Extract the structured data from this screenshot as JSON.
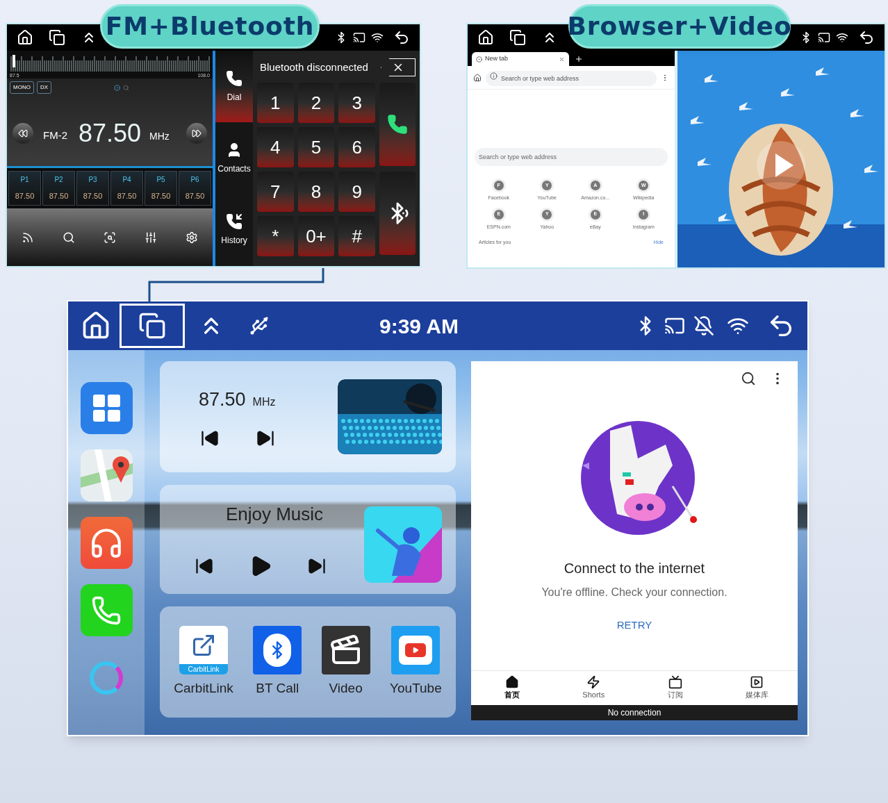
{
  "fm_bluetooth_panel": {
    "label": "FM+Bluetooth",
    "radio": {
      "scale_min": "87.5",
      "scale_max": "108.0",
      "modes": [
        "MONO",
        "DX"
      ],
      "band": "FM-2",
      "frequency": "87.50",
      "unit": "MHz",
      "presets": [
        {
          "name": "P1",
          "frequency": "87.50"
        },
        {
          "name": "P2",
          "frequency": "87.50"
        },
        {
          "name": "P3",
          "frequency": "87.50"
        },
        {
          "name": "P4",
          "frequency": "87.50"
        },
        {
          "name": "P5",
          "frequency": "87.50"
        },
        {
          "name": "P6",
          "frequency": "87.50"
        }
      ]
    },
    "phone": {
      "nav": [
        {
          "kind": "dial",
          "label": "Dial",
          "selected": true
        },
        {
          "kind": "contacts",
          "label": "Contacts",
          "selected": false
        },
        {
          "kind": "history",
          "label": "History",
          "selected": false
        }
      ],
      "status": "Bluetooth disconnected",
      "keys": [
        "1",
        "2",
        "3",
        "4",
        "5",
        "6",
        "7",
        "8",
        "9",
        "*",
        "0+",
        "#"
      ]
    }
  },
  "browser_video_panel": {
    "label": "Browser+Video",
    "browser": {
      "tab_title": "New tab",
      "address_placeholder": "Search or type web address",
      "search_placeholder": "Search or type web address",
      "shortcuts": [
        {
          "letter": "F",
          "name": "Facebook"
        },
        {
          "letter": "Y",
          "name": "YouTube"
        },
        {
          "letter": "A",
          "name": "Amazon.co..."
        },
        {
          "letter": "W",
          "name": "Wikipedia"
        },
        {
          "letter": "E",
          "name": "ESPN.com"
        },
        {
          "letter": "Y",
          "name": "Yahoo"
        },
        {
          "letter": "E",
          "name": "eBay"
        },
        {
          "letter": "I",
          "name": "Instagram"
        }
      ],
      "articles": "Articles for you",
      "hide": "Hide"
    }
  },
  "main_screen": {
    "status_bar": {
      "time": "9:39 AM"
    },
    "radio_card": {
      "frequency": "87.50",
      "unit": "MHz"
    },
    "music_card": {
      "title": "Enjoy Music"
    },
    "apps": [
      {
        "kind": "carbitlink",
        "label": "CarbitLink",
        "badge": "CarbitLink"
      },
      {
        "kind": "bt_call",
        "label": "BT Call"
      },
      {
        "kind": "video",
        "label": "Video"
      },
      {
        "kind": "youtube",
        "label": "YouTube"
      }
    ],
    "youtube": {
      "title": "Connect to the internet",
      "message": "You're offline. Check your connection.",
      "retry": "RETRY",
      "nav": [
        {
          "kind": "home",
          "label": "首页",
          "selected": true
        },
        {
          "kind": "shorts",
          "label": "Shorts",
          "selected": false
        },
        {
          "kind": "subscriptions",
          "label": "订阅",
          "selected": false
        },
        {
          "kind": "library",
          "label": "媒体库",
          "selected": false
        }
      ],
      "banner": "No connection"
    }
  }
}
